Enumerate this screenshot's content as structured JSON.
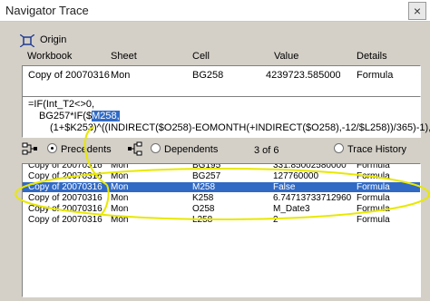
{
  "window": {
    "title": "Navigator Trace",
    "close_glyph": "×"
  },
  "origin": {
    "label": "Origin",
    "icon": "target-icon"
  },
  "columns": [
    "Workbook",
    "Sheet",
    "Cell",
    "Value",
    "Details"
  ],
  "origin_row": {
    "workbook": "Copy of 20070316",
    "sheet": "Mon",
    "cell": "BG258",
    "value": "4239723.58500004",
    "details": "Formula"
  },
  "formula": {
    "line1": "=IF(Int_T2<>0,",
    "line2_pre": "BG257*IF($",
    "line2_sel": "M258,",
    "line3": "(1+$K253)^((INDIRECT($O258)-EOMONTH(+INDIRECT($O258),-12/$L258))/365)-1),"
  },
  "modes": {
    "precedents": "Precedents",
    "dependents": "Dependents",
    "counter": "3 of 6",
    "history": "Trace History",
    "selected": "precedents"
  },
  "list_rows": [
    {
      "workbook": "Copy of 20070316",
      "sheet": "Mon",
      "cell": "BG195",
      "value": "331.85002580000",
      "details": "Formula",
      "selected": false
    },
    {
      "workbook": "Copy of 20070316",
      "sheet": "Mon",
      "cell": "BG257",
      "value": "127760000",
      "details": "Formula",
      "selected": false
    },
    {
      "workbook": "Copy of 20070316",
      "sheet": "Mon",
      "cell": "M258",
      "value": "False",
      "details": "Formula",
      "selected": true
    },
    {
      "workbook": "Copy of 20070316",
      "sheet": "Mon",
      "cell": "K258",
      "value": "6.74713733712960",
      "details": "Formula",
      "selected": false
    },
    {
      "workbook": "Copy of 20070316",
      "sheet": "Mon",
      "cell": "O258",
      "value": "M_Date3",
      "details": "Formula",
      "selected": false
    },
    {
      "workbook": "Copy of 20070316",
      "sheet": "Mon",
      "cell": "L258",
      "value": "2",
      "details": "Formula",
      "selected": false
    }
  ],
  "colors": {
    "selection": "#316ac5",
    "annotation": "#e8e800",
    "dialog": "#d4d0c8"
  }
}
